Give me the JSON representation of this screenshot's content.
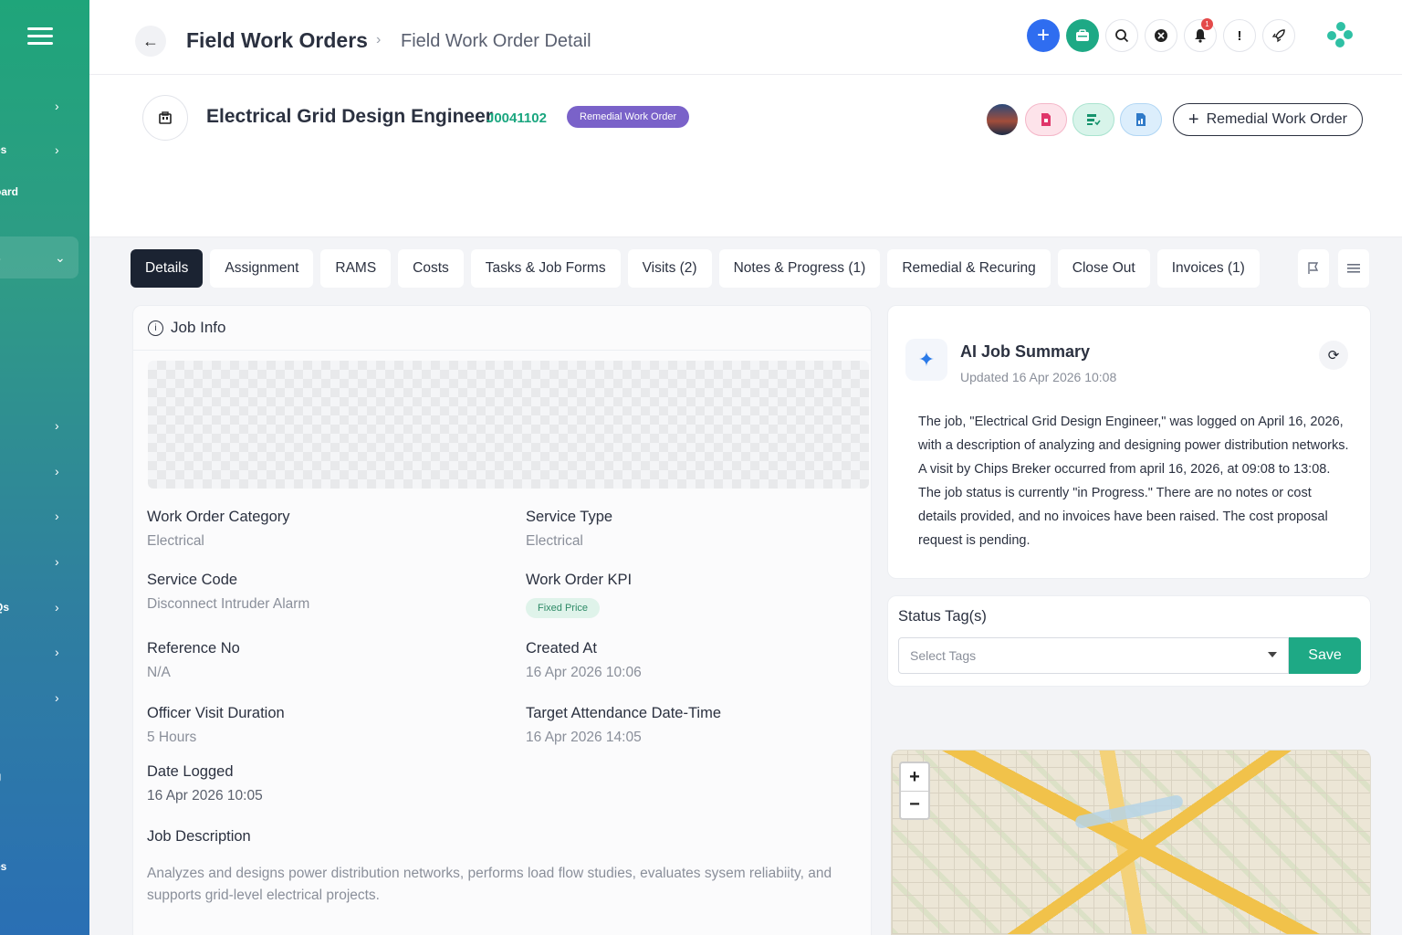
{
  "sidebar": {
    "items": [
      {
        "label": "",
        "chevron": "›"
      },
      {
        "label": "es",
        "chevron": "›"
      },
      {
        "label": "oard",
        "chevron": ""
      },
      {
        "label": "s",
        "chevron": "⌄"
      },
      {
        "label": "",
        "chevron": ""
      },
      {
        "label": "",
        "chevron": "›"
      },
      {
        "label": "/",
        "chevron": "›"
      },
      {
        "label": "",
        "chevron": "›"
      },
      {
        "label": "",
        "chevron": "›"
      },
      {
        "label": "Qs",
        "chevron": "›"
      },
      {
        "label": "",
        "chevron": "›"
      },
      {
        "label": "",
        "chevron": "›"
      },
      {
        "label": "g",
        "chevron": ""
      },
      {
        "label": "es",
        "chevron": ""
      }
    ]
  },
  "header": {
    "back_icon": "←",
    "breadcrumb_root": "Field Work Orders",
    "breadcrumb_sep": "›",
    "breadcrumb_current": "Field Work Order Detail",
    "notification_count": "1",
    "icons": [
      "add-icon",
      "work-orders-icon",
      "search-icon",
      "close-circle-icon",
      "bell-icon",
      "alert-icon",
      "rocket-icon",
      "logo-icon"
    ]
  },
  "job": {
    "title": "Electrical Grid Design Engineer",
    "code": "J0041102",
    "badge": "Remedial Work Order",
    "remedial_button": "Remedial Work Order",
    "remedial_button_icon": "+"
  },
  "tabs": [
    "Details",
    "Assignment",
    "RAMS",
    "Costs",
    "Tasks & Job Forms",
    "Visits (2)",
    "Notes & Progress (1)",
    "Remedial & Recuring",
    "Close Out",
    "Invoices (1)"
  ],
  "job_info": {
    "title": "Job Info",
    "fields": {
      "category_label": "Work Order Category",
      "category_value": "Electrical",
      "service_type_label": "Service Type",
      "service_type_value": "Electrical",
      "service_code_label": "Service Code",
      "service_code_value": "Disconnect Intruder Alarm",
      "kpi_label": "Work Order KPI",
      "kpi_value": "Fixed Price",
      "reference_label": "Reference No",
      "reference_value": "N/A",
      "created_label": "Created At",
      "created_value": "16 Apr 2026 10:06",
      "duration_label": "Officer Visit Duration",
      "duration_value": "5 Hours",
      "target_label": "Target Attendance Date-Time",
      "target_value": "16 Apr 2026 14:05",
      "logged_label": "Date Logged",
      "logged_value": "16 Apr 2026 10:05",
      "description_label": "Job Description",
      "description_value": "Analyzes and designs power distribution networks, performs load flow studies, evaluates sysem reliabiity, and supports grid-level electrical projects."
    }
  },
  "ai_summary": {
    "title": "AI Job Summary",
    "updated": "Updated 16 Apr 2026 10:08",
    "text": "The job, \"Electrical Grid Design Engineer,\" was logged on April 16, 2026, with a description of analyzing and designing power distribution networks. A visit by Chips Breker occurred from april 16, 2026, at 09:08 to 13:08. The job status is currently \"in Progress.\" There are no notes or cost details provided, and no invoices have been raised. The cost proposal request is pending."
  },
  "status_tags": {
    "label": "Status Tag(s)",
    "placeholder": "Select Tags",
    "save": "Save"
  },
  "map": {
    "zoom_in": "+",
    "zoom_out": "−"
  },
  "colors": {
    "accent_green": "#1ea985",
    "accent_blue": "#2f6df0",
    "badge_purple": "#7a62c9",
    "tab_active": "#1b2332"
  }
}
